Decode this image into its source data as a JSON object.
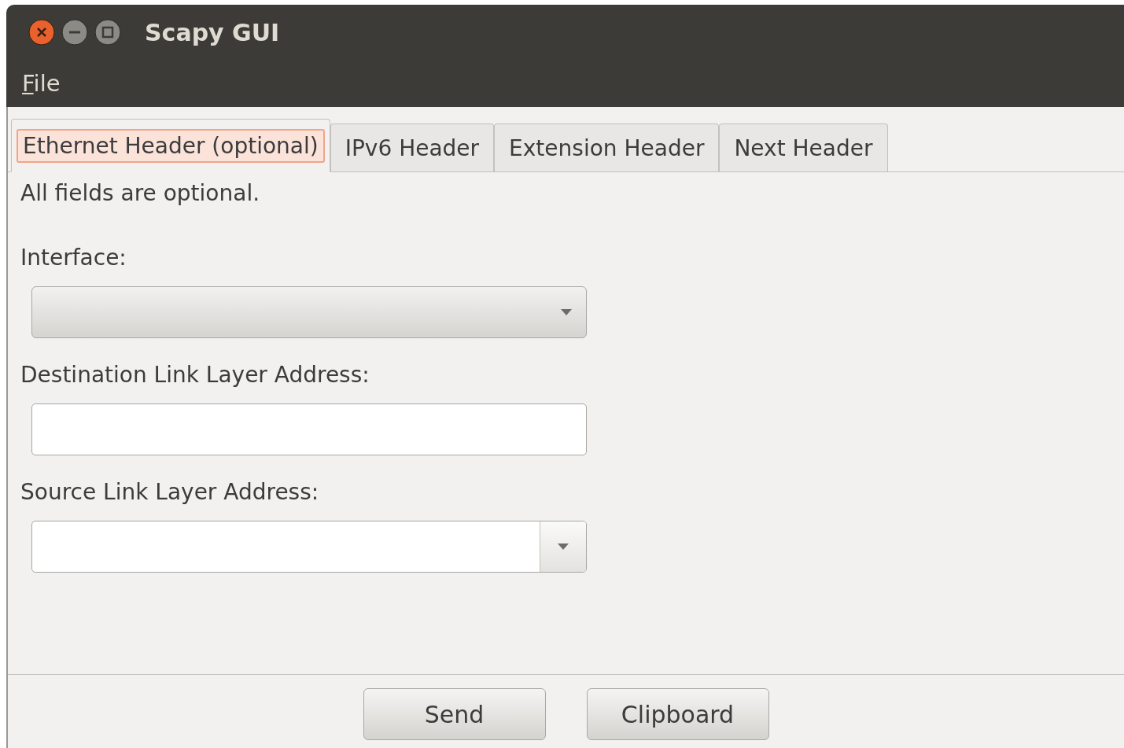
{
  "window": {
    "title": "Scapy GUI"
  },
  "menu": [
    {
      "label": "File",
      "mnemonic": true
    }
  ],
  "tabs": [
    {
      "label": "Ethernet Header (optional)",
      "selected": true
    },
    {
      "label": "IPv6 Header",
      "selected": false
    },
    {
      "label": "Extension Header",
      "selected": false
    },
    {
      "label": "Next Header",
      "selected": false
    }
  ],
  "note": "All fields are optional.",
  "fields": [
    {
      "kind": "combo",
      "label": "Interface:"
    },
    {
      "kind": "entry",
      "label": "Destination Link Layer Address:"
    },
    {
      "kind": "combo-entry",
      "label": "Source Link Layer Address:"
    }
  ],
  "buttons": [
    "Send",
    "Clipboard"
  ]
}
